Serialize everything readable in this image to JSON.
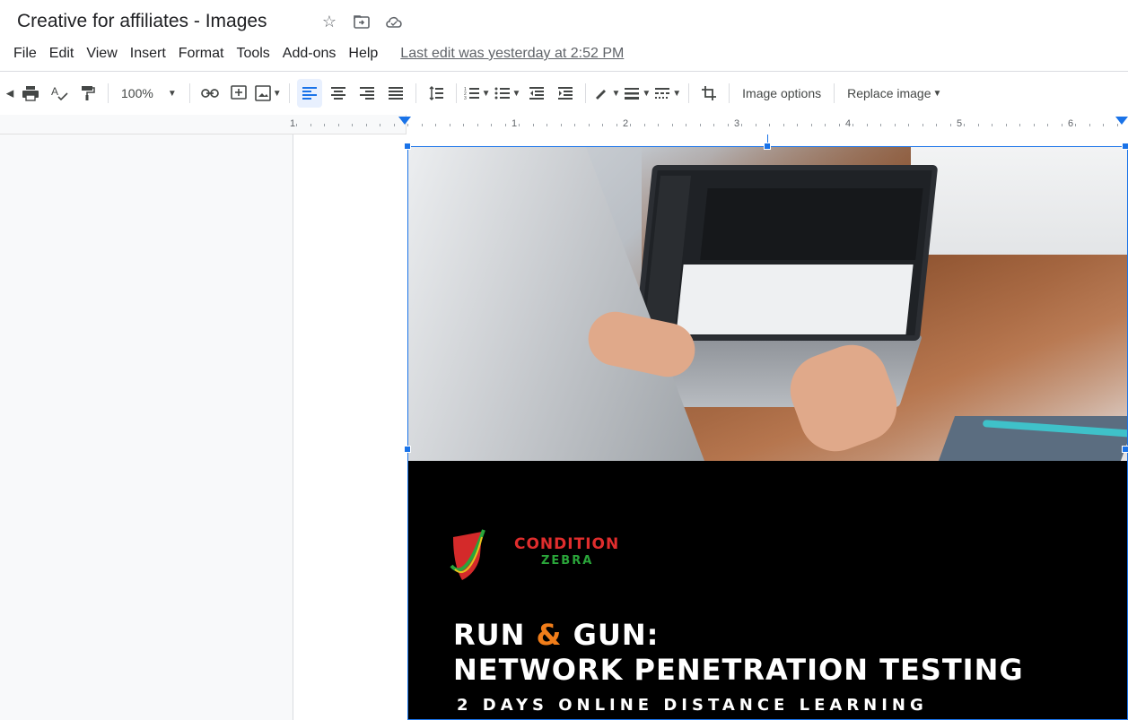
{
  "doc": {
    "title": "Creative for affiliates - Images",
    "last_edit": "Last edit was yesterday at 2:52 PM"
  },
  "menu": [
    "File",
    "Edit",
    "View",
    "Insert",
    "Format",
    "Tools",
    "Add-ons",
    "Help"
  ],
  "toolbar": {
    "zoom": "100%",
    "image_options": "Image options",
    "replace_image": "Replace image"
  },
  "ruler": {
    "labels": [
      "1",
      "1",
      "2",
      "3",
      "4",
      "5",
      "6"
    ]
  },
  "image": {
    "brand_line1": "CONDITION",
    "brand_line2": "ZEBRA",
    "headline_a": "RUN",
    "headline_amp": "&",
    "headline_b": "GUN:",
    "headline2": "NETWORK PENETRATION TESTING",
    "subline": "2 DAYS ONLINE  DISTANCE LEARNING"
  },
  "icons": [
    "star-icon",
    "move-to-folder-icon",
    "cloud-status-icon",
    "print-icon",
    "spellcheck-icon",
    "paint-format-icon",
    "link-icon",
    "comment-icon",
    "image-icon",
    "align-left-icon",
    "align-center-icon",
    "align-right-icon",
    "justify-icon",
    "line-spacing-icon",
    "numbered-list-icon",
    "bulleted-list-icon",
    "decrease-indent-icon",
    "increase-indent-icon",
    "border-color-icon",
    "border-weight-icon",
    "border-dash-icon",
    "crop-icon"
  ],
  "colors": {
    "accent": "#1a73e8",
    "brand_red": "#e02d2d",
    "brand_green": "#2aa53a",
    "amp_orange": "#f07d1a"
  }
}
